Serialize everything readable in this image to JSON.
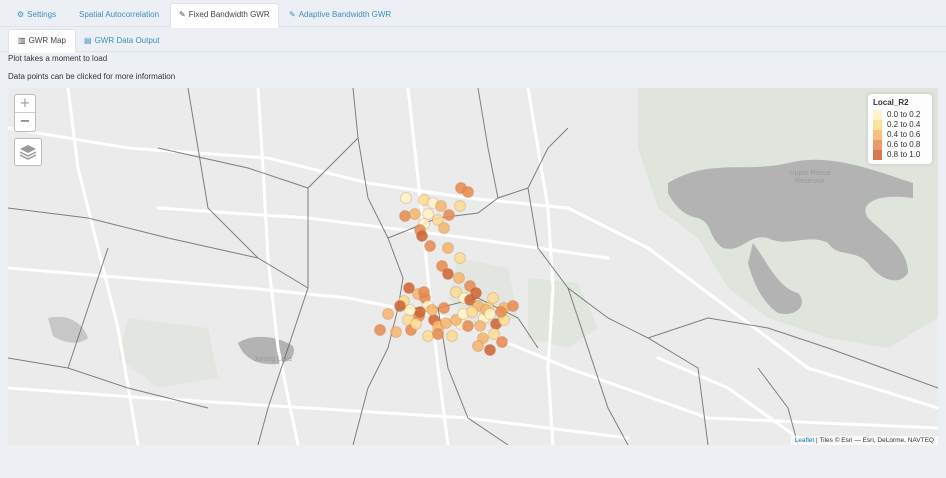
{
  "tabs": [
    {
      "label": "Settings",
      "icon": "gears-icon",
      "active": false
    },
    {
      "label": "Spatial Autocorrelation",
      "icon": "",
      "active": false
    },
    {
      "label": "Fixed Bandwidth GWR",
      "icon": "wrench-icon",
      "active": true
    },
    {
      "label": "Adaptive Bandwidth GWR",
      "icon": "wrench-icon",
      "active": false
    }
  ],
  "subtabs": [
    {
      "label": "GWR Map",
      "icon": "map-icon",
      "active": true
    },
    {
      "label": "GWR Data Output",
      "icon": "file-icon",
      "active": false
    }
  ],
  "notes": {
    "loading": "Plot takes a moment to load",
    "click_hint": "Data points can be clicked for more information"
  },
  "map": {
    "zoom_in": "+",
    "zoom_out": "−",
    "places": {
      "reservoir": "Upper Peirce\nReservoir",
      "lake": "Jurong Lake"
    },
    "legend": {
      "title": "Local_R2",
      "items": [
        {
          "label": "0.0 to 0.2",
          "color": "#fff5c8"
        },
        {
          "label": "0.2 to 0.4",
          "color": "#fddc8f"
        },
        {
          "label": "0.4 to 0.6",
          "color": "#f6b46b"
        },
        {
          "label": "0.6 to 0.8",
          "color": "#e88a4f"
        },
        {
          "label": "0.8 to 1.0",
          "color": "#cf6131"
        }
      ]
    },
    "attribution": {
      "link": "Leaflet",
      "text": " | Tiles © Esri — Esri, DeLorme, NAVTEQ"
    },
    "point_classes": [
      4,
      4,
      1,
      2,
      1,
      3,
      2,
      4,
      3,
      1,
      4,
      2,
      1,
      3,
      4,
      5,
      4,
      3,
      2,
      4,
      5,
      3,
      4,
      2,
      1,
      5,
      3,
      4,
      2,
      1,
      3,
      2,
      4,
      5,
      4,
      3,
      1,
      2,
      2,
      1,
      3,
      4,
      5,
      3,
      2,
      3,
      1,
      5,
      3,
      4,
      2,
      3,
      1,
      4,
      2,
      5,
      3,
      4,
      1,
      2,
      3,
      4,
      5,
      3,
      2,
      5,
      4,
      1,
      2,
      3,
      4,
      5,
      4,
      3
    ]
  }
}
